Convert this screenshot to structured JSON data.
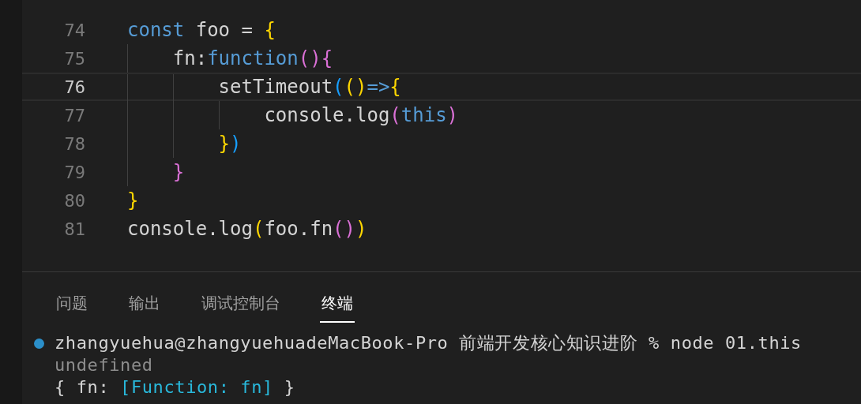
{
  "editor": {
    "lines": [
      {
        "number": "74",
        "current": false,
        "tokens": [
          {
            "text": "const",
            "kind": "keyword"
          },
          {
            "text": " foo = ",
            "kind": "plain"
          },
          {
            "text": "{",
            "kind": "brace1"
          }
        ]
      },
      {
        "number": "75",
        "current": false,
        "tokens": [
          {
            "text": "    fn:",
            "kind": "plain"
          },
          {
            "text": "function",
            "kind": "keyword"
          },
          {
            "text": "(){",
            "kind": "brace2"
          }
        ]
      },
      {
        "number": "76",
        "current": true,
        "tokens": [
          {
            "text": "        setTimeout",
            "kind": "plain"
          },
          {
            "text": "(",
            "kind": "brace3"
          },
          {
            "text": "()",
            "kind": "brace1"
          },
          {
            "text": "=>",
            "kind": "keyword"
          },
          {
            "text": "{",
            "kind": "brace1"
          }
        ]
      },
      {
        "number": "77",
        "current": false,
        "tokens": [
          {
            "text": "            console.log",
            "kind": "plain"
          },
          {
            "text": "(",
            "kind": "brace2"
          },
          {
            "text": "this",
            "kind": "keyword"
          },
          {
            "text": ")",
            "kind": "brace2"
          }
        ]
      },
      {
        "number": "78",
        "current": false,
        "tokens": [
          {
            "text": "        }",
            "kind": "brace1"
          },
          {
            "text": ")",
            "kind": "brace3"
          }
        ]
      },
      {
        "number": "79",
        "current": false,
        "tokens": [
          {
            "text": "    }",
            "kind": "brace2"
          }
        ]
      },
      {
        "number": "80",
        "current": false,
        "tokens": [
          {
            "text": "}",
            "kind": "brace1"
          }
        ]
      },
      {
        "number": "81",
        "current": false,
        "tokens": [
          {
            "text": "console.log",
            "kind": "plain"
          },
          {
            "text": "(",
            "kind": "brace1"
          },
          {
            "text": "foo.fn",
            "kind": "plain"
          },
          {
            "text": "()",
            "kind": "brace2"
          },
          {
            "text": ")",
            "kind": "brace1"
          }
        ]
      }
    ]
  },
  "panel": {
    "tabs": [
      {
        "label": "问题",
        "selected": false
      },
      {
        "label": "输出",
        "selected": false
      },
      {
        "label": "调试控制台",
        "selected": false
      },
      {
        "label": "终端",
        "selected": true
      }
    ],
    "terminal": [
      {
        "kind": "prompt",
        "tokens": [
          {
            "text": "zhangyuehua@zhangyuehuadeMacBook-Pro 前端开发核心知识进阶 % node 01.this",
            "kind": "plain"
          }
        ]
      },
      {
        "kind": "output",
        "tokens": [
          {
            "text": "undefined",
            "kind": "dim"
          }
        ]
      },
      {
        "kind": "output",
        "tokens": [
          {
            "text": "{ fn: ",
            "kind": "plain"
          },
          {
            "text": "[Function: fn]",
            "kind": "cyan"
          },
          {
            "text": " }",
            "kind": "plain"
          }
        ]
      }
    ]
  }
}
